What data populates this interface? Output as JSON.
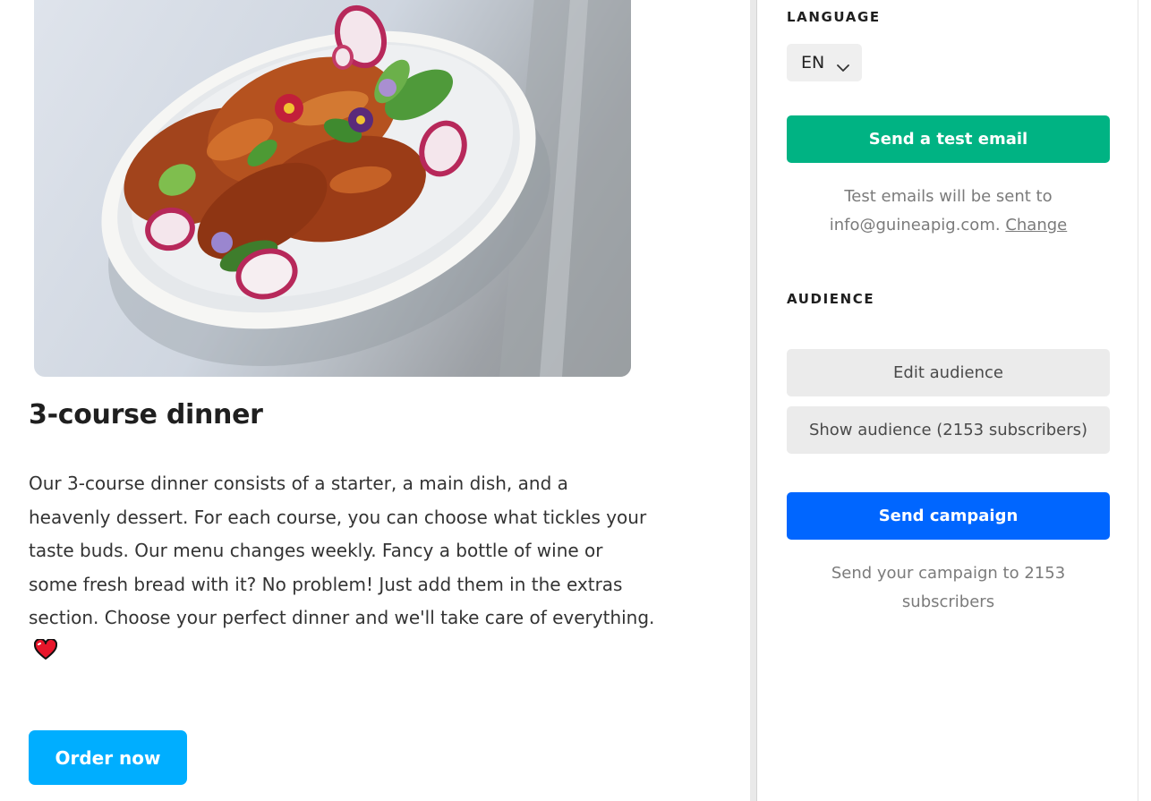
{
  "preview": {
    "image_alt": "Fried chicken with radish slices, herbs and edible flowers in a white bowl",
    "course_title": "3-course dinner",
    "course_description": "Our 3-course dinner consists of a starter, a main dish, and a heavenly dessert. For each course, you can choose what tickles your taste buds. Our menu changes weekly. Fancy a bottle of wine or some fresh bread with it? No problem! Just add them in the extras section. Choose your perfect dinner and we'll take care of everything.",
    "heart_icon": "heart-emoji",
    "order_button_label": "Order now"
  },
  "panel": {
    "language": {
      "heading": "LANGUAGE",
      "selected": "EN"
    },
    "test_email": {
      "button_label": "Send a test email",
      "info_prefix": "Test emails will be sent to",
      "email": "info@guineapig.com.",
      "change_link": "Change"
    },
    "audience": {
      "heading": "AUDIENCE",
      "edit_button": "Edit audience",
      "show_button": "Show audience (2153 subscribers)"
    },
    "campaign": {
      "send_button": "Send campaign",
      "info": "Send your campaign to 2153 subscribers"
    }
  },
  "colors": {
    "order_button": "#00aeff",
    "test_email_button": "#00b383",
    "send_campaign_button": "#0066ff",
    "secondary_button": "#ebebeb",
    "muted_text": "#7b7b7b"
  }
}
